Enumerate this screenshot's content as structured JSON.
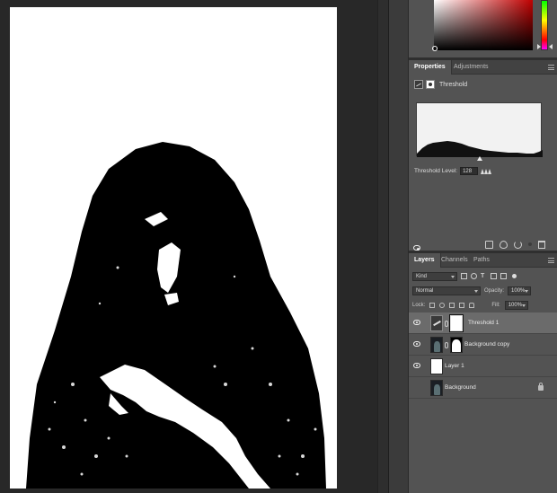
{
  "properties_panel": {
    "tabs": [
      {
        "label": "Properties",
        "active": true
      },
      {
        "label": "Adjustments",
        "active": false
      }
    ],
    "adjustment_title": "Threshold",
    "threshold_label": "Threshold Level:",
    "threshold_value": "128"
  },
  "layers_panel": {
    "tabs": [
      {
        "label": "Layers",
        "active": true
      },
      {
        "label": "Channels",
        "active": false
      },
      {
        "label": "Paths",
        "active": false
      }
    ],
    "filter_kind": "Kind",
    "blend_mode": "Normal",
    "opacity_label": "Opacity:",
    "opacity_value": "100%",
    "lock_label": "Lock:",
    "fill_label": "Fill:",
    "fill_value": "100%",
    "layers": [
      {
        "name": "Threshold 1",
        "selected": true
      },
      {
        "name": "Background copy",
        "selected": false
      },
      {
        "name": "Layer 1",
        "selected": false
      },
      {
        "name": "Background",
        "selected": false,
        "locked": true
      }
    ]
  },
  "colors": {
    "panel_bg": "#535353",
    "app_bg": "#282828",
    "selected_row": "#6b6b6b"
  }
}
